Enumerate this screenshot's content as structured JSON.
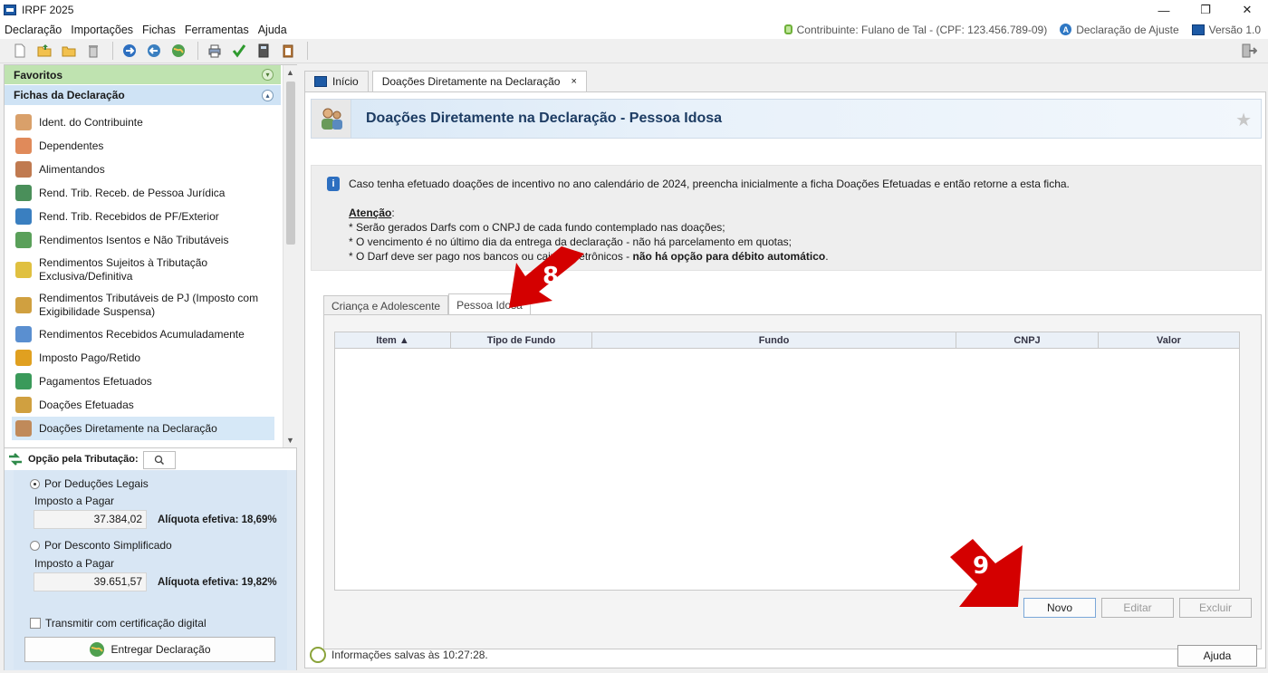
{
  "window": {
    "title": "IRPF 2025",
    "controls": [
      "—",
      "❐",
      "✕"
    ]
  },
  "menu": {
    "items": [
      "Declaração",
      "Importações",
      "Fichas",
      "Ferramentas",
      "Ajuda"
    ],
    "contribuinte": "Contribuinte: Fulano de Tal - (CPF: 123.456.789-09)",
    "tipo": "Declaração de Ajuste",
    "versao": "Versão 1.0"
  },
  "toolbar": {
    "icons": [
      "new-icon",
      "open-icon",
      "folder-icon",
      "trash-icon",
      "transmit-icon",
      "receive-icon",
      "globe-icon",
      "print-icon",
      "check-icon",
      "calculator-icon",
      "clipboard-icon",
      "exit-icon"
    ]
  },
  "sidebar": {
    "favoritos": "Favoritos",
    "fichas": "Fichas da Declaração",
    "items": [
      {
        "label": "Ident. do Contribuinte",
        "color": "#d9a06a"
      },
      {
        "label": "Dependentes",
        "color": "#e08a5a"
      },
      {
        "label": "Alimentandos",
        "color": "#c07a50"
      },
      {
        "label": "Rend. Trib. Receb. de Pessoa Jurídica",
        "color": "#4a8f5a"
      },
      {
        "label": "Rend. Trib. Recebidos de PF/Exterior",
        "color": "#3a7fc0"
      },
      {
        "label": "Rendimentos Isentos e Não Tributáveis",
        "color": "#5aa05a"
      },
      {
        "label": "Rendimentos Sujeitos à Tributação Exclusiva/Definitiva",
        "color": "#e0c040"
      },
      {
        "label": "Rendimentos Tributáveis de PJ (Imposto com Exigibilidade Suspensa)",
        "color": "#d0a040"
      },
      {
        "label": "Rendimentos Recebidos Acumuladamente",
        "color": "#5a8fd0"
      },
      {
        "label": "Imposto Pago/Retido",
        "color": "#e0a020"
      },
      {
        "label": "Pagamentos Efetuados",
        "color": "#3a9a5a"
      },
      {
        "label": "Doações Efetuadas",
        "color": "#d0a040"
      },
      {
        "label": "Doações Diretamente na Declaração",
        "color": "#c08a5a"
      }
    ]
  },
  "tax": {
    "title": "Opção pela Tributação:",
    "option1": "Por Deduções Legais",
    "imposto_label": "Imposto a Pagar",
    "value1": "37.384,02",
    "aliquota1": "Alíquota efetiva: 18,69%",
    "option2": "Por Desconto Simplificado",
    "value2": "39.651,57",
    "aliquota2": "Alíquota efetiva: 19,82%",
    "checkbox": "Transmitir com certificação digital",
    "deliver": "Entregar Declaração"
  },
  "tabs": {
    "home": "Início",
    "active": "Doações Diretamente na Declaração",
    "close": "×"
  },
  "page": {
    "title": "Doações Diretamente na Declaração - Pessoa Idosa",
    "info": "Caso tenha efetuado doações de incentivo no ano calendário de 2024, preencha inicialmente a ficha Doações Efetuadas e então retorne a esta ficha.",
    "attention_title": "Atenção",
    "attention_colon": ":",
    "lines": [
      "* Serão gerados Darfs com o CNPJ de cada fundo contemplado nas doações;",
      "* O vencimento é no último dia da entrega da declaração - não há parcelamento em quotas;"
    ],
    "line3_start": "* O Darf deve ser pago nos bancos ou caixas eletrônicos - ",
    "line3_bold": "não há opção para débito automático",
    "line3_end": "."
  },
  "subtabs": [
    "Criança e Adolescente",
    "Pessoa Idosa"
  ],
  "grid": {
    "columns": [
      "Item ▲",
      "Tipo de Fundo",
      "Fundo",
      "CNPJ",
      "Valor"
    ]
  },
  "buttons": {
    "novo": "Novo",
    "editar": "Editar",
    "excluir": "Excluir"
  },
  "status": {
    "text": "Informações salvas às 10:27:28.",
    "help": "Ajuda"
  },
  "annotations": {
    "step8": "8",
    "step9": "9",
    "color": "#d40000"
  }
}
